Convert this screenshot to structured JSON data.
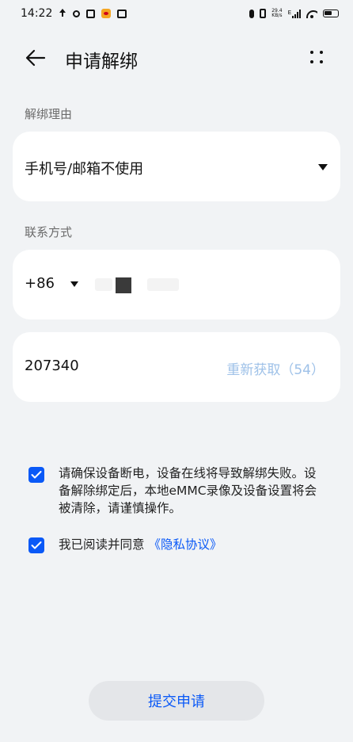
{
  "status_bar": {
    "time": "14:22",
    "net_speed_top": "29.4",
    "net_speed_bottom": "KB/s",
    "signal_label": "E"
  },
  "header": {
    "title": "申请解绑",
    "back_icon": "arrow-left-icon",
    "more_icon": "more-dots-icon"
  },
  "unbind_reason": {
    "label": "解绑理由",
    "selected": "手机号/邮箱不使用"
  },
  "contact": {
    "label": "联系方式",
    "country_code": "+86",
    "verification_code": "207340",
    "resend_label": "重新获取（54）"
  },
  "notices": {
    "warning_text": "请确保设备断电，设备在线将导致解绑失败。设备解除绑定后，本地eMMC录像及设备设置将会被清除，请谨慎操作。",
    "agree_prefix": "我已阅读并同意",
    "privacy_link": "《隐私协议》",
    "warning_checked": true,
    "agree_checked": true
  },
  "submit_label": "提交申请",
  "colors": {
    "accent": "#0a59f7",
    "background": "#f1f3f5",
    "resend_disabled": "#9ec1e8"
  }
}
